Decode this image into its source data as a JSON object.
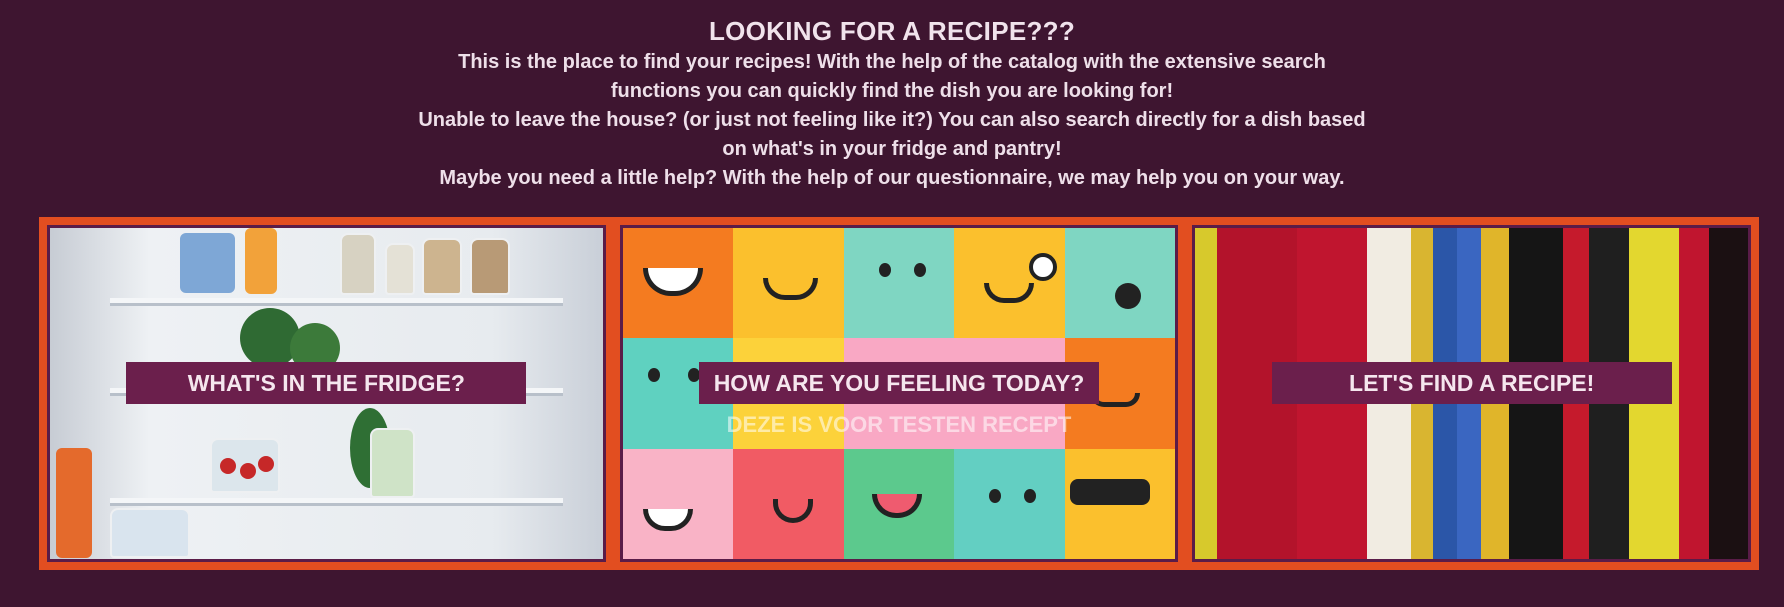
{
  "intro": {
    "title": "LOOKING FOR A RECIPE???",
    "line1": "This is the place to find your recipes! With the help of the catalog with the extensive search functions you can quickly find the dish you are looking for!",
    "line2": "Unable to leave the house? (or just not feeling like it?) You can also search directly for a dish based on what's in your fridge and pantry!",
    "line3": "Maybe you need a little help? With the help of our questionnaire, we may help you on your way."
  },
  "cards": [
    {
      "label": "WHAT'S IN THE FRIDGE?",
      "image": "fridge-photo"
    },
    {
      "label": "HOW ARE YOU FEELING TODAY?",
      "sublabel": "DEZE IS VOOR TESTEN RECEPT",
      "image": "emoji-grid"
    },
    {
      "label": "LET'S FIND A RECIPE!",
      "image": "cookbooks-photo"
    }
  ],
  "colors": {
    "background": "#3e1530",
    "card_frame": "#e24e20",
    "button": "#6b1f4c"
  }
}
